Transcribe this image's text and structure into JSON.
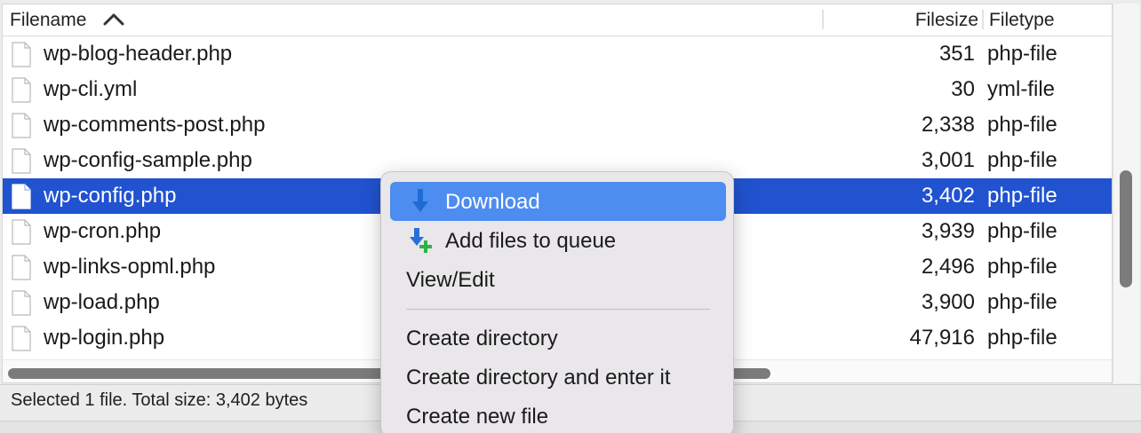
{
  "columns": {
    "filename": "Filename",
    "filesize": "Filesize",
    "filetype": "Filetype"
  },
  "files": [
    {
      "name": "wp-blog-header.php",
      "size": "351",
      "type": "php-file",
      "selected": false
    },
    {
      "name": "wp-cli.yml",
      "size": "30",
      "type": "yml-file",
      "selected": false
    },
    {
      "name": "wp-comments-post.php",
      "size": "2,338",
      "type": "php-file",
      "selected": false
    },
    {
      "name": "wp-config-sample.php",
      "size": "3,001",
      "type": "php-file",
      "selected": false
    },
    {
      "name": "wp-config.php",
      "size": "3,402",
      "type": "php-file",
      "selected": true
    },
    {
      "name": "wp-cron.php",
      "size": "3,939",
      "type": "php-file",
      "selected": false
    },
    {
      "name": "wp-links-opml.php",
      "size": "2,496",
      "type": "php-file",
      "selected": false
    },
    {
      "name": "wp-load.php",
      "size": "3,900",
      "type": "php-file",
      "selected": false
    },
    {
      "name": "wp-login.php",
      "size": "47,916",
      "type": "php-file",
      "selected": false
    }
  ],
  "status": {
    "text": "Selected 1 file. Total size: 3,402 bytes"
  },
  "context_menu": {
    "items": [
      {
        "label": "Download",
        "icon": "download-arrow-icon",
        "highlighted": true
      },
      {
        "label": "Add files to queue",
        "icon": "add-to-queue-icon",
        "highlighted": false
      },
      {
        "label": "View/Edit",
        "icon": "",
        "highlighted": false
      },
      {
        "label": "Create directory",
        "icon": "",
        "highlighted": false
      },
      {
        "label": "Create directory and enter it",
        "icon": "",
        "highlighted": false
      },
      {
        "label": "Create new file",
        "icon": "",
        "highlighted": false
      }
    ]
  },
  "colors": {
    "selection": "#2152cf",
    "menu_highlight": "#4d8df0",
    "menu_background": "#e9e7ea"
  }
}
